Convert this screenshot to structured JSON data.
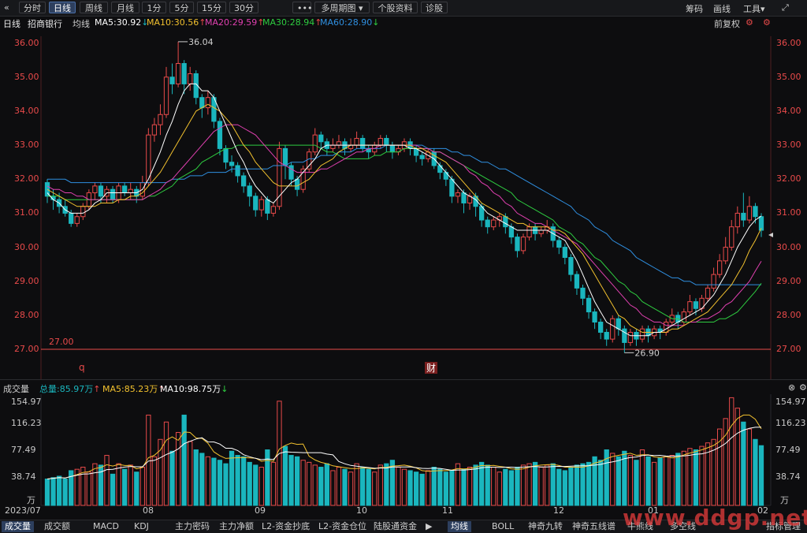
{
  "toolbar": {
    "back_icon": "«",
    "tabs": [
      "分时",
      "日线",
      "周线",
      "月线",
      "1分",
      "5分",
      "15分",
      "30分",
      "•••",
      "多周期图 ▾",
      "个股资料",
      "诊股"
    ],
    "active_tab": "日线",
    "right": [
      "筹码",
      "画线",
      "工具▾"
    ],
    "settings_icon": "gear-icon",
    "expand_icon": "expand-icon"
  },
  "info": {
    "period": "日线",
    "stock": "招商银行",
    "indicator": "均线",
    "ma5": "MA5:30.92",
    "ma10": "MA10:30.56",
    "ma20": "MA20:29.59",
    "ma30": "MA30:28.94",
    "ma60": "MA60:28.90",
    "adjust": "前复权"
  },
  "colors": {
    "up": "#e84a4a",
    "down": "#1ab6be",
    "ma5": "#ffffff",
    "ma10": "#f2c12e",
    "ma20": "#e040b0",
    "ma30": "#2ecc40",
    "ma60": "#2f8fe0",
    "ref_line": "#e84a4a"
  },
  "price_axis": [
    "36.00",
    "35.00",
    "34.00",
    "33.00",
    "32.00",
    "31.00",
    "30.00",
    "29.00",
    "28.00",
    "27.00"
  ],
  "annotations": {
    "high": "36.04",
    "low": "26.90",
    "ref": "27.00",
    "q_marker": "q",
    "cai_marker": "财"
  },
  "volume_bar": {
    "title": "成交量",
    "total": "总量:85.97万",
    "ma5": "MA5:85.23万",
    "ma10": "MA10:98.75万"
  },
  "volume_axis": [
    "154.97",
    "116.23",
    "77.49",
    "38.74",
    "万"
  ],
  "date_axis": [
    "2023/07",
    "08",
    "09",
    "10",
    "11",
    "12",
    "01",
    "02"
  ],
  "bottom_tabs_left": [
    "成交量",
    "成交额",
    "MACD",
    "KDJ",
    "主力密码",
    "主力净额",
    "L2-资金抄底",
    "L2-资金仓位",
    "陆股通资金"
  ],
  "bottom_tabs_right": [
    "均线",
    "BOLL",
    "神奇九转",
    "神奇五线谱",
    "牛熊线",
    "多空线"
  ],
  "bottom_right": "指标管理",
  "watermark": "www.ddgp.net",
  "chart_data": {
    "type": "candlestick",
    "ylim": [
      26.7,
      36.2
    ],
    "candles": [
      [
        31.9,
        31.5,
        32.0,
        31.3
      ],
      [
        31.5,
        31.4,
        31.7,
        31.1
      ],
      [
        31.4,
        31.2,
        31.6,
        31.0
      ],
      [
        31.2,
        31.0,
        31.4,
        30.9
      ],
      [
        31.0,
        30.7,
        31.1,
        30.6
      ],
      [
        30.7,
        30.9,
        31.0,
        30.6
      ],
      [
        30.9,
        31.2,
        31.3,
        30.8
      ],
      [
        31.2,
        31.6,
        31.7,
        31.1
      ],
      [
        31.6,
        31.8,
        31.9,
        31.4
      ],
      [
        31.8,
        31.5,
        31.9,
        31.3
      ],
      [
        31.5,
        31.7,
        31.8,
        31.3
      ],
      [
        31.7,
        31.4,
        31.8,
        31.3
      ],
      [
        31.4,
        31.8,
        31.9,
        31.3
      ],
      [
        31.8,
        31.6,
        31.9,
        31.5
      ],
      [
        31.6,
        31.7,
        31.9,
        31.4
      ],
      [
        31.7,
        31.5,
        31.8,
        31.3
      ],
      [
        31.5,
        31.9,
        32.1,
        31.4
      ],
      [
        31.9,
        33.3,
        33.5,
        31.8
      ],
      [
        33.3,
        33.6,
        33.8,
        33.1
      ],
      [
        33.6,
        33.9,
        34.2,
        33.3
      ],
      [
        33.9,
        35.0,
        35.3,
        33.8
      ],
      [
        35.0,
        34.8,
        35.4,
        34.5
      ],
      [
        34.8,
        35.4,
        36.04,
        34.7
      ],
      [
        35.4,
        34.8,
        35.5,
        34.5
      ],
      [
        34.8,
        35.1,
        35.3,
        34.6
      ],
      [
        35.1,
        34.4,
        35.2,
        34.2
      ],
      [
        34.4,
        34.1,
        34.5,
        33.8
      ],
      [
        34.1,
        34.4,
        34.6,
        33.9
      ],
      [
        34.4,
        33.7,
        34.5,
        33.5
      ],
      [
        33.7,
        32.9,
        33.8,
        32.7
      ],
      [
        32.9,
        32.5,
        33.0,
        32.3
      ],
      [
        32.5,
        32.4,
        32.7,
        32.2
      ],
      [
        32.4,
        32.1,
        32.5,
        31.9
      ],
      [
        32.1,
        31.8,
        32.2,
        31.6
      ],
      [
        31.8,
        31.5,
        31.9,
        31.2
      ],
      [
        31.5,
        31.1,
        31.6,
        30.9
      ],
      [
        31.1,
        31.4,
        31.5,
        30.9
      ],
      [
        31.4,
        31.0,
        31.5,
        30.8
      ],
      [
        31.0,
        31.2,
        31.3,
        30.9
      ],
      [
        31.2,
        32.9,
        33.1,
        31.1
      ],
      [
        32.9,
        32.4,
        33.0,
        32.0
      ],
      [
        32.4,
        32.0,
        32.5,
        31.8
      ],
      [
        32.0,
        31.7,
        32.1,
        31.5
      ],
      [
        31.7,
        32.3,
        32.4,
        31.6
      ],
      [
        32.3,
        32.8,
        32.9,
        32.2
      ],
      [
        32.8,
        33.3,
        33.5,
        32.7
      ],
      [
        33.3,
        33.1,
        33.4,
        32.9
      ],
      [
        33.1,
        32.9,
        33.2,
        32.7
      ],
      [
        32.9,
        33.0,
        33.2,
        32.8
      ],
      [
        33.0,
        33.1,
        33.3,
        32.9
      ],
      [
        33.1,
        32.9,
        33.2,
        32.7
      ],
      [
        32.9,
        33.0,
        33.2,
        32.8
      ],
      [
        33.0,
        33.2,
        33.4,
        32.9
      ],
      [
        33.2,
        32.9,
        33.3,
        32.8
      ],
      [
        32.9,
        32.8,
        33.0,
        32.6
      ],
      [
        32.8,
        33.0,
        33.1,
        32.7
      ],
      [
        33.0,
        33.2,
        33.3,
        32.9
      ],
      [
        33.2,
        33.0,
        33.3,
        32.8
      ],
      [
        33.0,
        32.8,
        33.1,
        32.6
      ],
      [
        32.8,
        32.9,
        33.0,
        32.7
      ],
      [
        32.9,
        33.1,
        33.2,
        32.8
      ],
      [
        33.1,
        32.9,
        33.2,
        32.7
      ],
      [
        32.9,
        32.7,
        33.0,
        32.5
      ],
      [
        32.7,
        32.6,
        32.8,
        32.4
      ],
      [
        32.6,
        32.8,
        32.9,
        32.5
      ],
      [
        32.8,
        32.4,
        32.9,
        32.3
      ],
      [
        32.4,
        32.2,
        32.5,
        32.0
      ],
      [
        32.2,
        32.0,
        32.3,
        31.8
      ],
      [
        32.0,
        31.5,
        32.1,
        31.3
      ],
      [
        31.5,
        31.6,
        31.7,
        31.3
      ],
      [
        31.6,
        31.3,
        31.7,
        31.0
      ],
      [
        31.3,
        31.5,
        31.6,
        31.1
      ],
      [
        31.5,
        31.2,
        31.6,
        30.9
      ],
      [
        31.2,
        30.8,
        31.3,
        30.6
      ],
      [
        30.8,
        30.6,
        30.9,
        30.4
      ],
      [
        30.6,
        30.8,
        30.9,
        30.5
      ],
      [
        30.8,
        30.9,
        31.0,
        30.6
      ],
      [
        30.9,
        30.6,
        31.0,
        30.4
      ],
      [
        30.6,
        30.3,
        30.7,
        30.1
      ],
      [
        30.3,
        29.9,
        30.4,
        29.7
      ],
      [
        29.9,
        30.3,
        30.4,
        29.8
      ],
      [
        30.3,
        30.6,
        30.7,
        30.2
      ],
      [
        30.6,
        30.4,
        30.7,
        30.2
      ],
      [
        30.4,
        30.5,
        30.6,
        30.3
      ],
      [
        30.5,
        30.6,
        30.8,
        30.4
      ],
      [
        30.6,
        30.2,
        30.7,
        30.0
      ],
      [
        30.2,
        30.0,
        30.3,
        29.8
      ],
      [
        30.0,
        29.7,
        30.1,
        29.5
      ],
      [
        29.7,
        29.2,
        29.8,
        29.0
      ],
      [
        29.2,
        28.8,
        29.3,
        28.6
      ],
      [
        28.8,
        28.5,
        28.9,
        28.3
      ],
      [
        28.5,
        28.1,
        28.6,
        27.9
      ],
      [
        28.1,
        27.8,
        28.2,
        27.6
      ],
      [
        27.8,
        27.5,
        27.9,
        27.3
      ],
      [
        27.5,
        27.3,
        27.6,
        27.1
      ],
      [
        27.3,
        27.9,
        28.0,
        27.2
      ],
      [
        27.9,
        27.6,
        28.0,
        27.4
      ],
      [
        27.6,
        27.2,
        27.7,
        26.9
      ],
      [
        27.2,
        27.5,
        27.6,
        27.1
      ],
      [
        27.5,
        27.3,
        27.6,
        27.1
      ],
      [
        27.3,
        27.6,
        27.7,
        27.2
      ],
      [
        27.6,
        27.4,
        27.7,
        27.2
      ],
      [
        27.4,
        27.6,
        27.7,
        27.3
      ],
      [
        27.6,
        27.5,
        27.7,
        27.3
      ],
      [
        27.5,
        27.8,
        27.9,
        27.4
      ],
      [
        27.8,
        28.0,
        28.2,
        27.7
      ],
      [
        28.0,
        27.8,
        28.1,
        27.6
      ],
      [
        27.8,
        28.1,
        28.2,
        27.7
      ],
      [
        28.1,
        28.4,
        28.6,
        28.0
      ],
      [
        28.4,
        28.2,
        28.5,
        28.0
      ],
      [
        28.2,
        28.5,
        28.6,
        28.1
      ],
      [
        28.5,
        28.8,
        28.9,
        28.4
      ],
      [
        28.8,
        29.2,
        29.4,
        28.7
      ],
      [
        29.2,
        29.6,
        29.8,
        29.1
      ],
      [
        29.6,
        30.0,
        30.3,
        29.5
      ],
      [
        30.0,
        30.6,
        30.8,
        29.9
      ],
      [
        30.6,
        31.0,
        31.2,
        30.4
      ],
      [
        31.0,
        30.8,
        31.6,
        30.6
      ],
      [
        30.8,
        31.2,
        31.5,
        30.7
      ],
      [
        31.2,
        30.9,
        31.3,
        30.7
      ],
      [
        30.9,
        30.5,
        31.0,
        30.3
      ]
    ],
    "ma5": [
      31.6,
      31.4,
      31.3,
      31.1,
      31.0,
      31.0,
      31.0,
      31.1,
      31.3,
      31.4,
      31.6,
      31.6,
      31.6,
      31.6,
      31.6,
      31.6,
      31.7,
      32.0,
      32.4,
      32.8,
      33.3,
      33.7,
      34.2,
      34.6,
      34.8,
      34.8,
      34.6,
      34.6,
      34.4,
      34.0,
      33.6,
      33.2,
      32.8,
      32.5,
      32.1,
      31.8,
      31.6,
      31.4,
      31.3,
      31.5,
      31.7,
      31.9,
      32.0,
      32.2,
      32.4,
      32.6,
      32.9,
      33.0,
      33.0,
      33.0,
      33.0,
      33.0,
      33.0,
      33.0,
      33.0,
      33.0,
      33.0,
      33.0,
      33.0,
      33.0,
      33.0,
      32.9,
      32.9,
      32.8,
      32.7,
      32.6,
      32.4,
      32.2,
      32.0,
      31.8,
      31.6,
      31.5,
      31.4,
      31.2,
      31.0,
      30.9,
      30.8,
      30.7,
      30.6,
      30.5,
      30.5,
      30.5,
      30.5,
      30.5,
      30.5,
      30.4,
      30.3,
      30.2,
      29.9,
      29.6,
      29.2,
      28.8,
      28.4,
      28.1,
      27.8,
      27.7,
      27.6,
      27.5,
      27.4,
      27.4,
      27.4,
      27.4,
      27.5,
      27.5,
      27.6,
      27.7,
      27.8,
      27.9,
      28.0,
      28.1,
      28.2,
      28.4,
      28.6,
      28.9,
      29.2,
      29.6,
      30.0,
      30.3,
      30.6,
      30.8,
      30.92
    ],
    "ma10": [
      31.7,
      31.6,
      31.5,
      31.4,
      31.3,
      31.2,
      31.2,
      31.2,
      31.2,
      31.3,
      31.3,
      31.3,
      31.4,
      31.4,
      31.5,
      31.5,
      31.6,
      31.8,
      32.0,
      32.2,
      32.5,
      32.8,
      33.1,
      33.4,
      33.7,
      34.0,
      34.1,
      34.2,
      34.1,
      34.0,
      33.8,
      33.6,
      33.3,
      33.0,
      32.8,
      32.5,
      32.3,
      32.1,
      31.9,
      31.8,
      31.8,
      31.8,
      31.8,
      31.9,
      32.0,
      32.2,
      32.4,
      32.5,
      32.6,
      32.8,
      32.9,
      33.0,
      33.0,
      33.0,
      33.0,
      33.0,
      33.0,
      33.0,
      33.0,
      33.0,
      33.0,
      33.0,
      32.9,
      32.9,
      32.8,
      32.7,
      32.6,
      32.5,
      32.3,
      32.1,
      31.9,
      31.7,
      31.5,
      31.3,
      31.2,
      31.1,
      31.0,
      30.9,
      30.8,
      30.7,
      30.7,
      30.6,
      30.6,
      30.6,
      30.6,
      30.5,
      30.5,
      30.4,
      30.2,
      30.0,
      29.8,
      29.5,
      29.2,
      28.9,
      28.6,
      28.3,
      28.0,
      27.9,
      27.7,
      27.6,
      27.5,
      27.5,
      27.5,
      27.5,
      27.5,
      27.6,
      27.6,
      27.7,
      27.8,
      27.9,
      28.0,
      28.1,
      28.3,
      28.5,
      28.7,
      28.9,
      29.2,
      29.5,
      29.9,
      30.2,
      30.56
    ],
    "ma20": [
      31.8,
      31.7,
      31.7,
      31.6,
      31.6,
      31.5,
      31.5,
      31.4,
      31.4,
      31.4,
      31.4,
      31.4,
      31.4,
      31.4,
      31.4,
      31.4,
      31.4,
      31.5,
      31.6,
      31.7,
      31.9,
      32.0,
      32.2,
      32.4,
      32.6,
      32.8,
      33.0,
      33.2,
      33.4,
      33.5,
      33.6,
      33.6,
      33.6,
      33.5,
      33.4,
      33.3,
      33.1,
      32.9,
      32.7,
      32.5,
      32.4,
      32.3,
      32.2,
      32.2,
      32.2,
      32.2,
      32.3,
      32.3,
      32.4,
      32.5,
      32.6,
      32.7,
      32.8,
      32.8,
      32.9,
      32.9,
      33.0,
      33.0,
      33.0,
      33.0,
      33.0,
      33.0,
      33.0,
      32.9,
      32.9,
      32.8,
      32.8,
      32.7,
      32.6,
      32.5,
      32.4,
      32.2,
      32.1,
      31.9,
      31.8,
      31.6,
      31.5,
      31.3,
      31.2,
      31.0,
      30.9,
      30.8,
      30.7,
      30.7,
      30.6,
      30.5,
      30.4,
      30.3,
      30.2,
      30.1,
      29.9,
      29.7,
      29.5,
      29.3,
      29.1,
      28.9,
      28.7,
      28.5,
      28.3,
      28.2,
      28.0,
      27.9,
      27.8,
      27.8,
      27.7,
      27.7,
      27.7,
      27.7,
      27.8,
      27.8,
      27.9,
      27.9,
      28.0,
      28.1,
      28.3,
      28.4,
      28.6,
      28.8,
      29.0,
      29.3,
      29.59
    ],
    "ma30": [
      31.5,
      31.5,
      31.5,
      31.4,
      31.4,
      31.4,
      31.4,
      31.4,
      31.4,
      31.4,
      31.4,
      31.4,
      31.4,
      31.4,
      31.4,
      31.4,
      31.4,
      31.5,
      31.5,
      31.6,
      31.7,
      31.8,
      32.0,
      32.1,
      32.2,
      32.3,
      32.5,
      32.6,
      32.7,
      32.8,
      32.9,
      32.9,
      33.0,
      33.0,
      33.0,
      33.0,
      33.0,
      33.0,
      33.0,
      33.0,
      33.0,
      33.0,
      33.0,
      33.0,
      33.0,
      33.0,
      32.9,
      32.8,
      32.8,
      32.7,
      32.6,
      32.6,
      32.6,
      32.6,
      32.6,
      32.7,
      32.7,
      32.8,
      32.8,
      32.8,
      32.9,
      32.9,
      32.9,
      32.9,
      32.9,
      32.8,
      32.8,
      32.7,
      32.6,
      32.5,
      32.4,
      32.3,
      32.2,
      32.1,
      32.0,
      31.9,
      31.8,
      31.7,
      31.6,
      31.4,
      31.3,
      31.2,
      31.1,
      31.0,
      30.9,
      30.8,
      30.6,
      30.5,
      30.4,
      30.2,
      30.1,
      29.9,
      29.7,
      29.6,
      29.4,
      29.2,
      29.0,
      28.9,
      28.7,
      28.6,
      28.4,
      28.3,
      28.2,
      28.1,
      28.0,
      27.9,
      27.9,
      27.8,
      27.8,
      27.8,
      27.8,
      27.8,
      27.8,
      27.9,
      27.9,
      28.0,
      28.1,
      28.3,
      28.5,
      28.7,
      28.94
    ],
    "ma60": [
      32.0,
      32.0,
      32.0,
      32.0,
      31.9,
      31.9,
      31.9,
      31.9,
      31.9,
      31.9,
      31.9,
      31.9,
      31.9,
      31.9,
      31.9,
      31.9,
      31.9,
      31.9,
      31.9,
      31.9,
      31.9,
      32.0,
      32.0,
      32.0,
      32.1,
      32.1,
      32.1,
      32.2,
      32.2,
      32.2,
      32.2,
      32.3,
      32.3,
      32.3,
      32.3,
      32.3,
      32.3,
      32.3,
      32.4,
      32.4,
      32.4,
      32.5,
      32.5,
      32.5,
      32.6,
      32.6,
      32.7,
      32.7,
      32.7,
      32.8,
      32.8,
      32.8,
      32.9,
      32.9,
      32.9,
      32.9,
      32.9,
      33.0,
      33.0,
      33.0,
      33.0,
      33.0,
      33.0,
      33.0,
      32.9,
      32.9,
      32.9,
      32.9,
      32.8,
      32.8,
      32.7,
      32.7,
      32.6,
      32.5,
      32.5,
      32.4,
      32.3,
      32.3,
      32.2,
      32.1,
      32.0,
      31.9,
      31.8,
      31.7,
      31.6,
      31.5,
      31.4,
      31.3,
      31.2,
      31.0,
      30.9,
      30.8,
      30.6,
      30.5,
      30.4,
      30.2,
      30.1,
      30.0,
      29.9,
      29.7,
      29.6,
      29.5,
      29.4,
      29.3,
      29.2,
      29.1,
      29.1,
      29.0,
      29.0,
      28.9,
      28.9,
      28.9,
      28.9,
      28.9,
      28.9,
      28.9,
      28.9,
      28.9,
      28.9,
      28.9,
      28.9
    ],
    "volume": [
      38,
      40,
      42,
      38,
      50,
      52,
      55,
      48,
      60,
      58,
      72,
      45,
      60,
      52,
      58,
      48,
      55,
      130,
      70,
      95,
      120,
      78,
      105,
      130,
      92,
      80,
      75,
      70,
      68,
      65,
      60,
      78,
      72,
      70,
      62,
      58,
      55,
      80,
      62,
      150,
      85,
      72,
      70,
      65,
      62,
      58,
      55,
      60,
      50,
      55,
      52,
      48,
      60,
      55,
      52,
      48,
      58,
      60,
      65,
      55,
      52,
      50,
      48,
      45,
      50,
      55,
      52,
      48,
      50,
      60,
      52,
      55,
      58,
      62,
      58,
      55,
      48,
      52,
      50,
      55,
      58,
      60,
      62,
      55,
      58,
      60,
      52,
      50,
      55,
      58,
      60,
      62,
      70,
      65,
      80,
      75,
      70,
      78,
      72,
      65,
      80,
      70,
      62,
      68,
      70,
      72,
      75,
      78,
      82,
      80,
      85,
      90,
      95,
      110,
      125,
      155,
      140,
      120,
      110,
      95,
      86
    ],
    "vol_ylim": [
      0,
      160
    ]
  }
}
